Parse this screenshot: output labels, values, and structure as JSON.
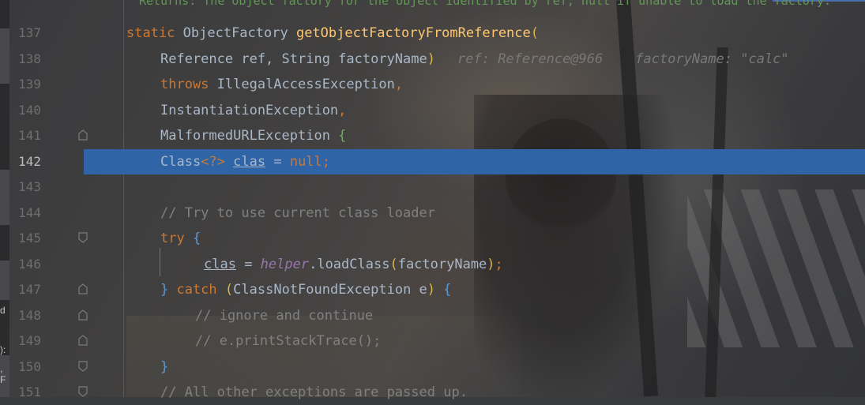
{
  "editor": {
    "doc_comment": "Returns: The object factory for the object identified by ref; null if unable to load the factory.",
    "current_line": "142",
    "lines": [
      {
        "num": "137",
        "segments": [
          {
            "t": "static ",
            "c": "kw"
          },
          {
            "t": "ObjectFactory ",
            "c": ""
          },
          {
            "t": "getObjectFactoryFromReference",
            "c": "fn"
          },
          {
            "t": "(",
            "c": "br1"
          }
        ]
      },
      {
        "num": "138",
        "segments": [
          {
            "t": "Reference ref, String factoryName",
            "c": ""
          },
          {
            "t": ")",
            "c": "br1"
          }
        ],
        "hint": "ref: Reference@966    factoryName: \"calc\""
      },
      {
        "num": "139",
        "segments": [
          {
            "t": "throws ",
            "c": "kw"
          },
          {
            "t": "IllegalAccessException",
            "c": ""
          },
          {
            "t": ",",
            "c": "kw"
          }
        ]
      },
      {
        "num": "140",
        "segments": [
          {
            "t": "InstantiationException",
            "c": ""
          },
          {
            "t": ",",
            "c": "kw"
          }
        ]
      },
      {
        "num": "141",
        "segments": [
          {
            "t": "MalformedURLException ",
            "c": ""
          },
          {
            "t": "{",
            "c": "br2"
          }
        ]
      },
      {
        "num": "142",
        "segments": [
          {
            "t": "Class",
            "c": ""
          },
          {
            "t": "<?>",
            "c": "kw"
          },
          {
            "t": " ",
            "c": ""
          },
          {
            "t": "clas",
            "c": "ul"
          },
          {
            "t": " = ",
            "c": ""
          },
          {
            "t": "null",
            "c": "kw"
          },
          {
            "t": ";",
            "c": "kw"
          }
        ]
      },
      {
        "num": "143",
        "segments": []
      },
      {
        "num": "144",
        "segments": [
          {
            "t": "// Try to use current class loader",
            "c": "cm"
          }
        ]
      },
      {
        "num": "145",
        "segments": [
          {
            "t": "try ",
            "c": "kw"
          },
          {
            "t": "{",
            "c": "br3"
          }
        ]
      },
      {
        "num": "146",
        "segments": [
          {
            "t": "clas",
            "c": "ul"
          },
          {
            "t": " = ",
            "c": ""
          },
          {
            "t": "helper",
            "c": "it"
          },
          {
            "t": ".loadClass",
            "c": ""
          },
          {
            "t": "(",
            "c": "br1"
          },
          {
            "t": "factoryName",
            "c": ""
          },
          {
            "t": ")",
            "c": "br1"
          },
          {
            "t": ";",
            "c": "kw"
          }
        ]
      },
      {
        "num": "147",
        "segments": [
          {
            "t": "}",
            "c": "br3"
          },
          {
            "t": " catch ",
            "c": "kw"
          },
          {
            "t": "(",
            "c": "br1"
          },
          {
            "t": "ClassNotFoundException e",
            "c": ""
          },
          {
            "t": ")",
            "c": "br1"
          },
          {
            "t": " ",
            "c": ""
          },
          {
            "t": "{",
            "c": "br3"
          }
        ]
      },
      {
        "num": "148",
        "segments": [
          {
            "t": "// ignore and continue",
            "c": "cm"
          }
        ]
      },
      {
        "num": "149",
        "segments": [
          {
            "t": "// e.printStackTrace();",
            "c": "cm"
          }
        ]
      },
      {
        "num": "150",
        "segments": [
          {
            "t": "}",
            "c": "br3"
          }
        ]
      },
      {
        "num": "151",
        "segments": [
          {
            "t": "// All other exceptions are passed up.",
            "c": "cm"
          }
        ]
      }
    ]
  },
  "left_panel": {
    "fragments": [
      "d",
      "):",
      ", F"
    ]
  },
  "icons": {
    "fold_open": "fold-open-icon",
    "fold_close": "fold-close-icon"
  },
  "colors": {
    "highlight": "#2f65a6",
    "keyword": "#cc7832",
    "function": "#ffc66d",
    "comment": "#808080",
    "field": "#9876aa",
    "text": "#a9b7c6"
  }
}
